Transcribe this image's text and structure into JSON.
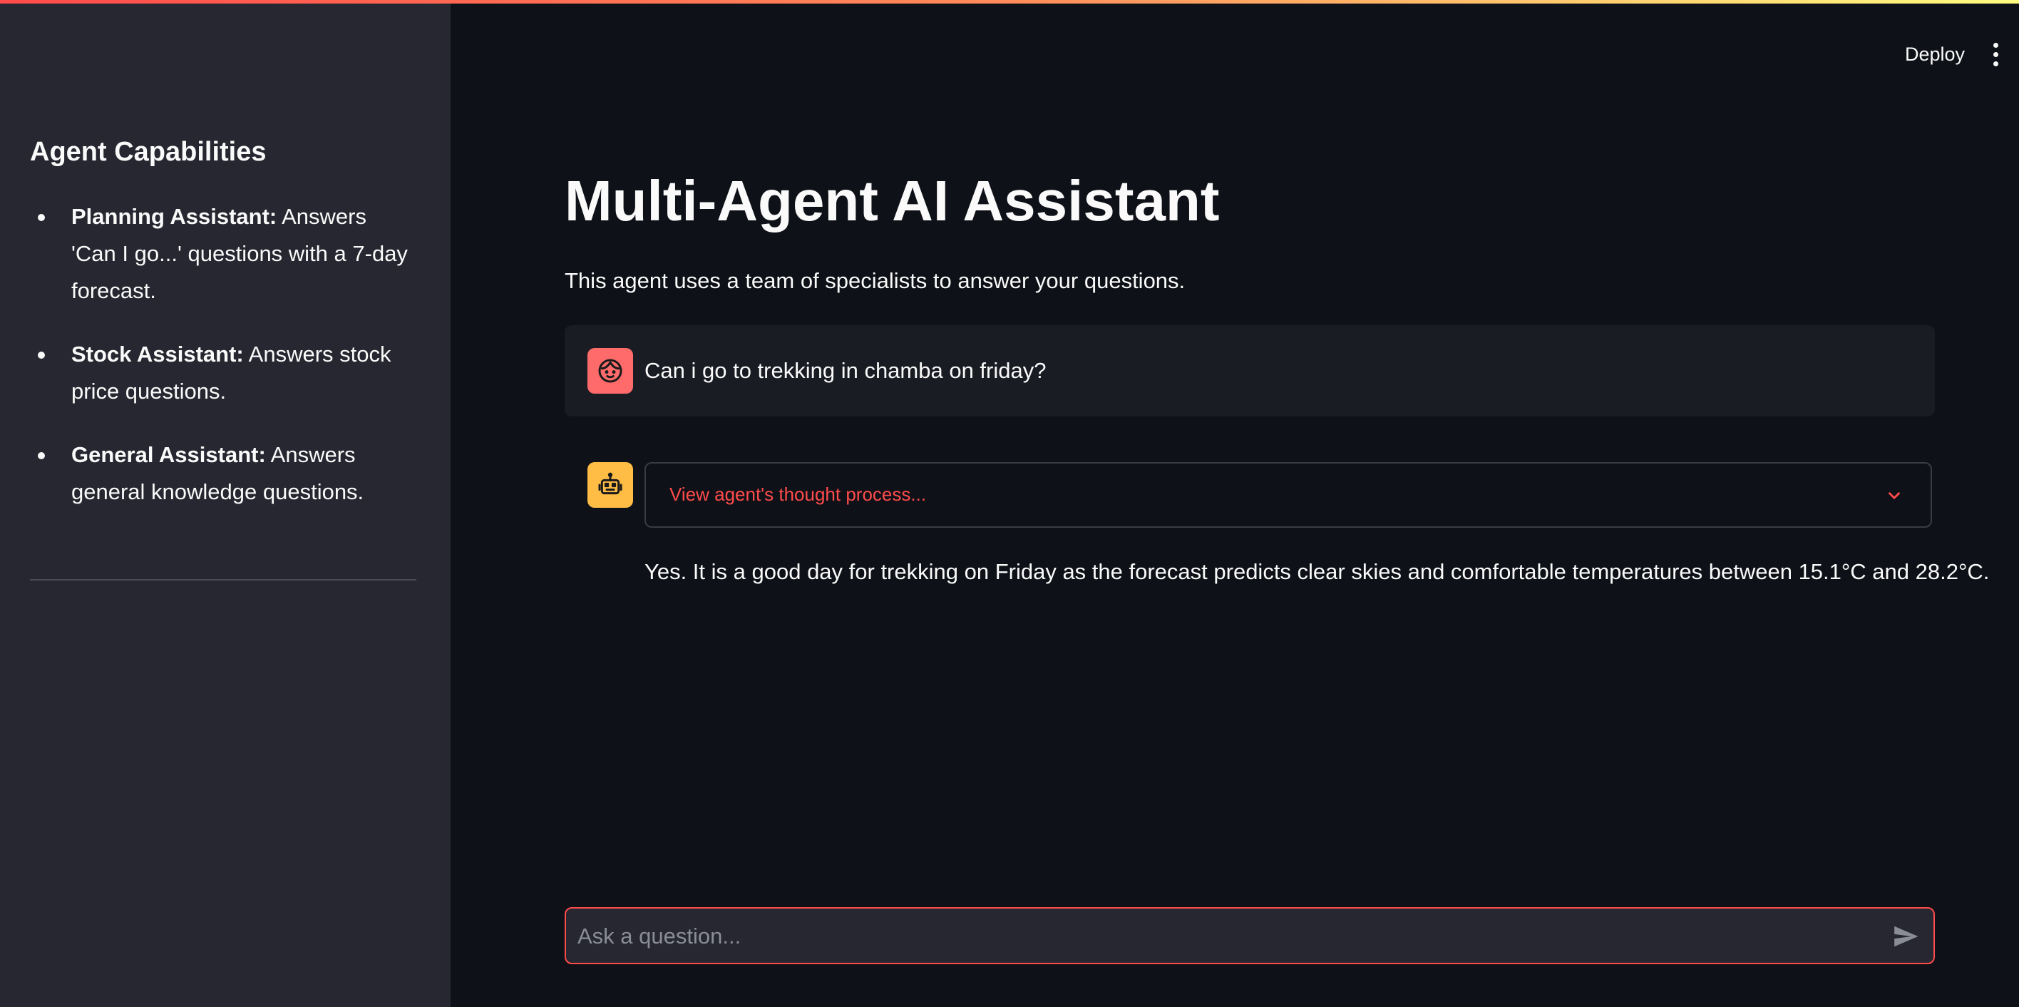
{
  "sidebar": {
    "title": "Agent Capabilities",
    "items": [
      {
        "name": "Planning Assistant:",
        "description": " Answers 'Can I go...' questions with a 7-day forecast."
      },
      {
        "name": "Stock Assistant:",
        "description": " Answers stock price questions."
      },
      {
        "name": "General Assistant:",
        "description": " Answers general knowledge questions."
      }
    ]
  },
  "header": {
    "deploy_label": "Deploy",
    "menu_icon": "vertical-ellipsis-icon"
  },
  "main": {
    "title": "Multi-Agent AI Assistant",
    "caption": "This agent uses a team of specialists to answer your questions."
  },
  "chat": {
    "user_message": "Can i go to trekking in chamba on friday?",
    "user_avatar_icon": "smiley-face-icon",
    "assistant_avatar_icon": "robot-icon",
    "expander_label": "View agent's thought process...",
    "answer": "Yes. It is a good day for trekking on Friday as the forecast predicts clear skies and comfortable temperatures between 15.1°C and 28.2°C."
  },
  "input": {
    "placeholder": "Ask a question...",
    "value": ""
  },
  "colors": {
    "background": "#0e1117",
    "sidebar": "#262730",
    "accent": "#ff4b4b",
    "user_avatar": "#ff6b6b",
    "assistant_avatar": "#ffbd45"
  }
}
